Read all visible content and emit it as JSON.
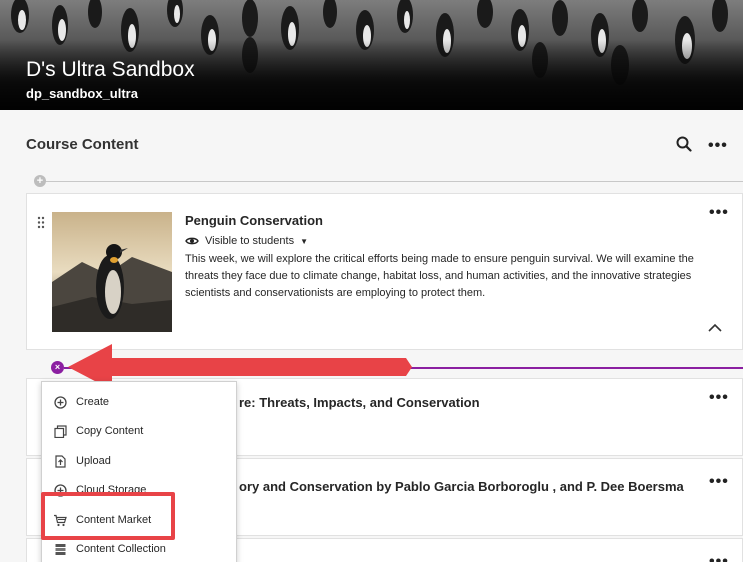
{
  "course": {
    "title": "D's Ultra Sandbox",
    "id": "dp_sandbox_ultra"
  },
  "header": {
    "section_title": "Course Content",
    "search_icon": "search-icon",
    "more_label": "•••"
  },
  "items": [
    {
      "title": "Penguin Conservation",
      "visibility": "Visible to students",
      "description": "This week, we will explore the critical efforts being made to ensure penguin survival. We will examine the threats they face due to climate change, habitat loss, and human activities, and the innovative strategies scientists and conservationists are employing to protect them."
    },
    {
      "title_partial": "re: Threats, Impacts, and Conservation"
    },
    {
      "title_partial": "ory and Conservation by Pablo Garcia Borboroglu , and P. Dee Boersma"
    }
  ],
  "menu": {
    "items": [
      {
        "label": "Create",
        "icon": "plus-circle-icon"
      },
      {
        "label": "Copy Content",
        "icon": "copy-icon"
      },
      {
        "label": "Upload",
        "icon": "upload-icon"
      },
      {
        "label": "Cloud Storage",
        "icon": "cloud-storage-icon"
      },
      {
        "label": "Content Market",
        "icon": "cart-icon"
      },
      {
        "label": "Content Collection",
        "icon": "collection-icon"
      }
    ]
  },
  "colors": {
    "accent_purple": "#8b1fa1",
    "annotation_red": "#e84347"
  }
}
